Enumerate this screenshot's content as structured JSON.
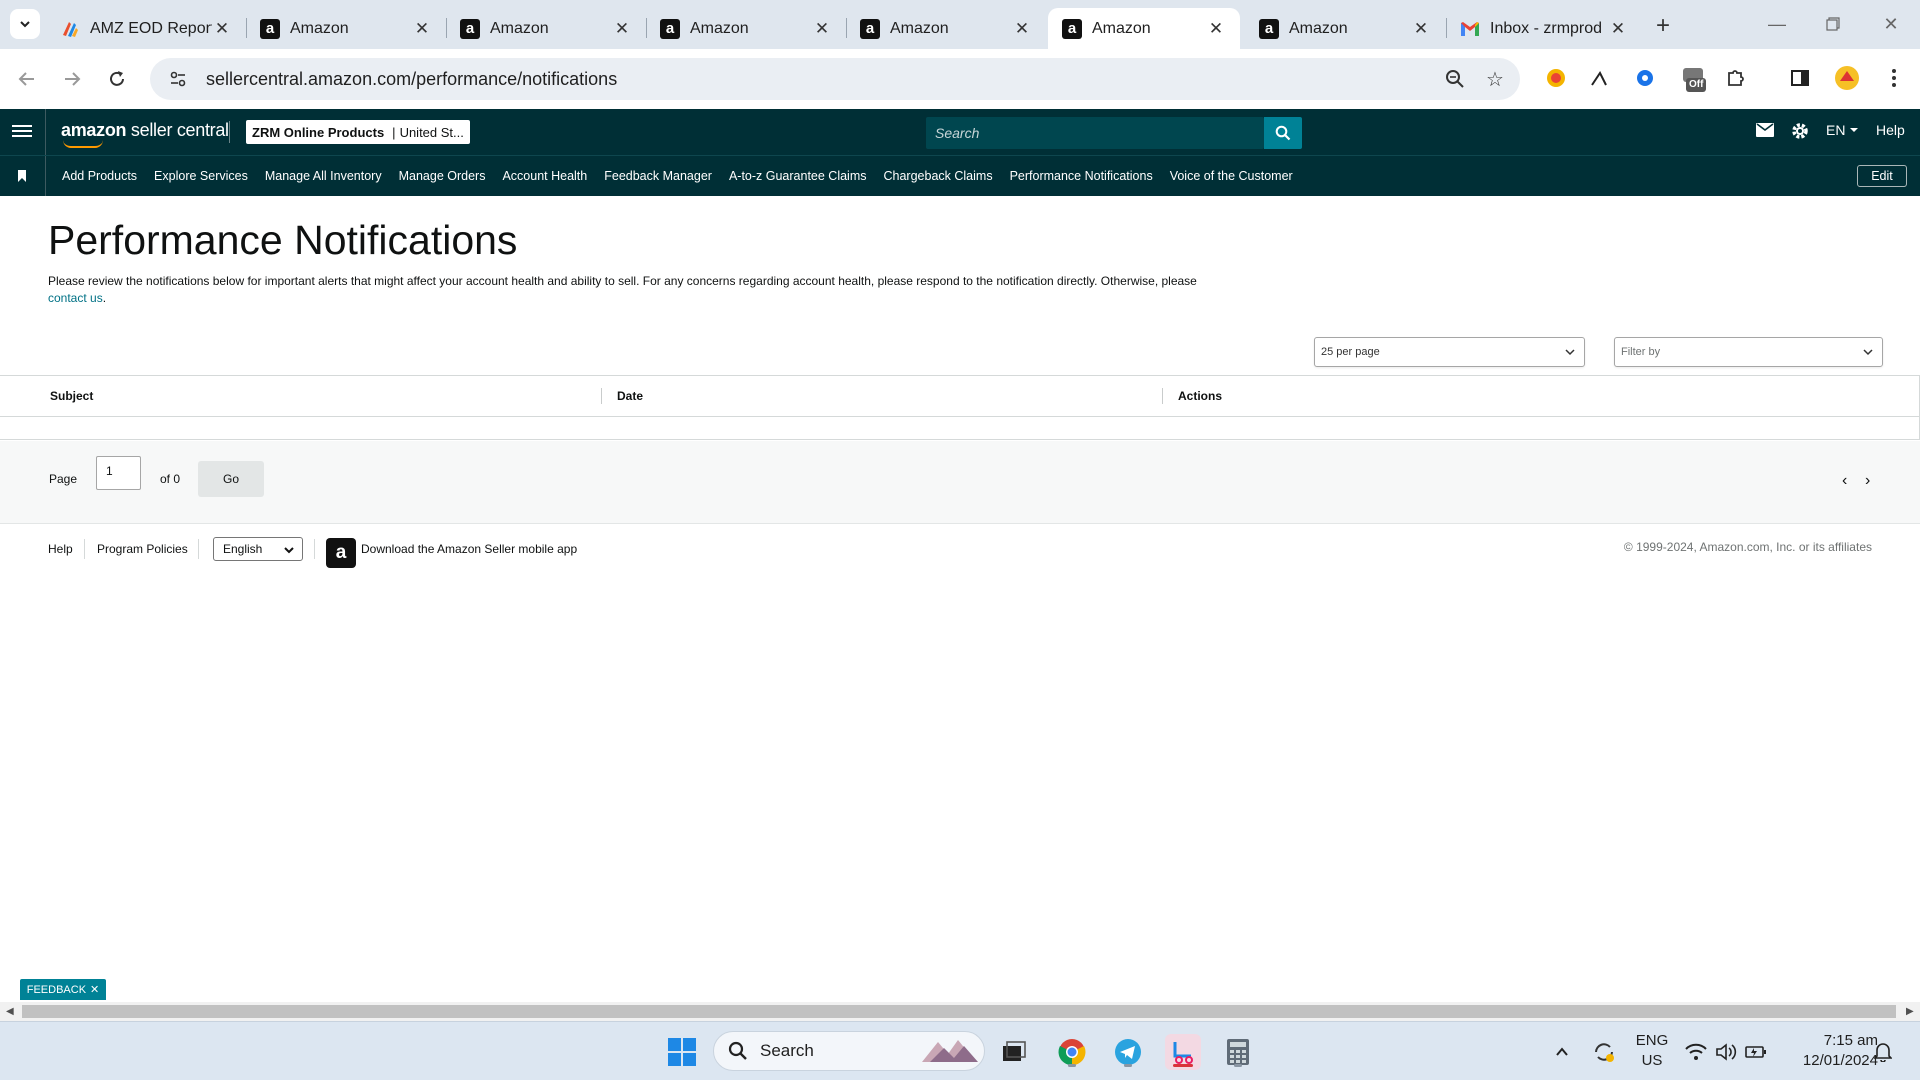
{
  "browser": {
    "tabs": [
      {
        "title": "AMZ EOD Report",
        "icon": "zoho-logo-icon",
        "active": false
      },
      {
        "title": "Amazon",
        "icon": "amazon-icon",
        "active": false
      },
      {
        "title": "Amazon",
        "icon": "amazon-icon",
        "active": false
      },
      {
        "title": "Amazon",
        "icon": "amazon-icon",
        "active": false
      },
      {
        "title": "Amazon",
        "icon": "amazon-icon",
        "active": false
      },
      {
        "title": "Amazon",
        "icon": "amazon-icon",
        "active": true
      },
      {
        "title": "Amazon",
        "icon": "amazon-icon",
        "active": false
      },
      {
        "title": "Inbox - zrmprod",
        "icon": "gmail-icon",
        "active": false
      }
    ],
    "url": "sellercentral.amazon.com/performance/notifications",
    "extension_badge": "Off"
  },
  "header": {
    "logo_amazon": "amazon",
    "logo_rest": " seller central",
    "account_name": "ZRM Online Products",
    "account_region": "United St...",
    "search_placeholder": "Search",
    "language": "EN",
    "help": "Help"
  },
  "nav": {
    "links": [
      "Add Products",
      "Explore Services",
      "Manage All Inventory",
      "Manage Orders",
      "Account Health",
      "Feedback Manager",
      "A-to-z Guarantee Claims",
      "Chargeback Claims",
      "Performance Notifications",
      "Voice of the Customer"
    ],
    "edit": "Edit"
  },
  "main": {
    "title": "Performance Notifications",
    "description": "Please review the notifications below for important alerts that might affect your account health and ability to sell. For any concerns regarding account health, please respond to the notification directly. Otherwise, please",
    "contact_link": "contact us",
    "description_end": ".",
    "per_page": "25 per page",
    "filter_placeholder": "Filter by",
    "columns": [
      "Subject",
      "Date",
      "Actions"
    ],
    "pager": {
      "page_label": "Page",
      "page_value": "1",
      "of_label": "of 0",
      "go": "Go"
    }
  },
  "footer": {
    "help": "Help",
    "program_policies": "Program Policies",
    "language": "English",
    "app_text": "Download the Amazon Seller mobile app",
    "copyright": "© 1999-2024, Amazon.com, Inc. or its affiliates"
  },
  "feedback": "FEEDBACK",
  "taskbar": {
    "search": "Search",
    "lang_line1": "ENG",
    "lang_line2": "US",
    "time": "7:15 am",
    "date": "12/01/2024"
  },
  "colors": {
    "header_bg": "#002f36",
    "accent_teal": "#008296",
    "link": "#007185"
  }
}
